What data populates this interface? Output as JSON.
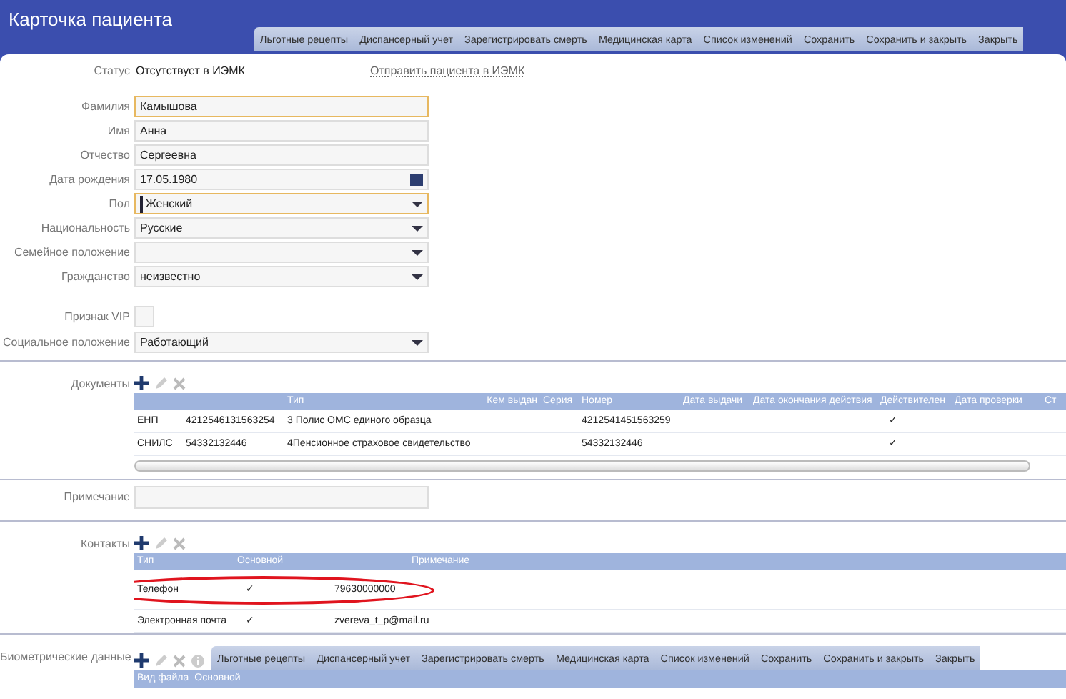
{
  "window": {
    "title": "Карточка пациента"
  },
  "toolbar": [
    "Льготные рецепты",
    "Диспансерный учет",
    "Зарегистрировать смерть",
    "Медицинская карта",
    "Список изменений",
    "Сохранить",
    "Сохранить и закрыть",
    "Закрыть"
  ],
  "status": {
    "label": "Статус",
    "value": "Отсутствует в ИЭМК",
    "link": "Отправить пациента в ИЭМК"
  },
  "fields": [
    {
      "label": "Фамилия",
      "kind": "text",
      "value": "Камышова",
      "focused": true
    },
    {
      "label": "Имя",
      "kind": "text",
      "value": "Анна",
      "focused": false
    },
    {
      "label": "Отчество",
      "kind": "text",
      "value": "Сергеевна",
      "focused": false
    },
    {
      "label": "Дата рождения",
      "kind": "date",
      "value": "17.05.1980",
      "focused": false
    },
    {
      "label": "Пол",
      "kind": "select",
      "value": "Женский",
      "focused": true
    },
    {
      "label": "Национальность",
      "kind": "select",
      "value": "Русские",
      "focused": false
    },
    {
      "label": "Семейное положение",
      "kind": "select",
      "focused": false
    },
    {
      "label": "Гражданство",
      "kind": "select",
      "value": "неизвестно",
      "focused": false
    },
    {
      "label": "Признак VIP",
      "kind": "checkbox",
      "checked": false
    },
    {
      "label": "Социальное положение",
      "kind": "select",
      "value": "Работающий",
      "focused": false
    }
  ],
  "documents": {
    "label": "Документы",
    "columns": [
      "",
      "",
      "Тип",
      "Кем выдан",
      "Серия",
      "Номер",
      "Дата выдачи",
      "Дата окончания действия",
      "Действителен",
      "Дата проверки",
      "Ст"
    ],
    "rows": [
      [
        "ЕНП",
        "4212546131563254",
        "3 Полис ОМС единого образца",
        "",
        "",
        "4212541451563259",
        "",
        "",
        "✓",
        ""
      ],
      [
        "СНИЛС",
        "54332132446",
        "4Пенсионное страховое свидетельство",
        "",
        "",
        "54332132446",
        "",
        "",
        "✓",
        ""
      ]
    ]
  },
  "note": {
    "label": "Примечание"
  },
  "contacts": {
    "label": "Контакты",
    "columns": [
      "Тип",
      "Основной",
      "Примечание"
    ],
    "rows": [
      {
        "type": "Телефон",
        "main": "✓",
        "value": "79630000000"
      },
      {
        "type": "Электронная почта",
        "main": "✓",
        "value": "zvereva_t_p@mail.ru"
      }
    ]
  },
  "biometrics": {
    "label": "Биометрические данные",
    "columns": [
      "Вид файла",
      "Основной"
    ],
    "toolbar": [
      "Льготные рецепты",
      "Диспансерный учет",
      "Зарегистрировать смерть",
      "Медицинская карта",
      "Список изменений",
      "Сохранить",
      "Сохранить и закрыть",
      "Закрыть"
    ]
  }
}
